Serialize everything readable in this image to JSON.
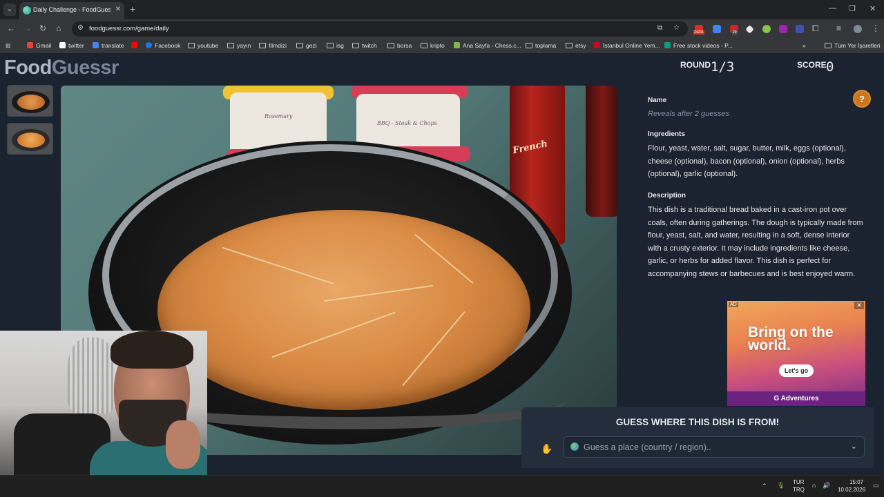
{
  "browser": {
    "tab_title": "Daily Challenge - FoodGuessr |",
    "url": "foodguessr.com/game/daily",
    "bookmarks": [
      {
        "label": "Gmail",
        "kind": "site",
        "color": "#ea4335"
      },
      {
        "label": "twitter",
        "kind": "site",
        "color": "#ffffff"
      },
      {
        "label": "translate",
        "kind": "site",
        "color": "#4285f4"
      },
      {
        "label": "",
        "kind": "site",
        "color": "#ff0000"
      },
      {
        "label": "Facebook",
        "kind": "site",
        "color": "#1877f2"
      },
      {
        "label": "youtube",
        "kind": "folder"
      },
      {
        "label": "yayın",
        "kind": "folder"
      },
      {
        "label": "filmdizi",
        "kind": "folder"
      },
      {
        "label": "gezi",
        "kind": "folder"
      },
      {
        "label": "isg",
        "kind": "folder"
      },
      {
        "label": "twitch",
        "kind": "folder"
      },
      {
        "label": "borsa",
        "kind": "folder"
      },
      {
        "label": "kripto",
        "kind": "folder"
      },
      {
        "label": "Ana Sayfa - Chess.c...",
        "kind": "site",
        "color": "#81b64c"
      },
      {
        "label": "toplama",
        "kind": "folder"
      },
      {
        "label": "etsy",
        "kind": "folder"
      },
      {
        "label": "İstanbul Online Yem...",
        "kind": "site",
        "color": "#d6001c"
      },
      {
        "label": "Free stock videos - P...",
        "kind": "site",
        "color": "#05a081"
      }
    ],
    "all_bookmarks": "Tüm Yer İşaretleri"
  },
  "game": {
    "logo_food": "Food",
    "logo_guessr": "Guessr",
    "round_label": "ROUND",
    "round_value": "1/3",
    "score_label": "SCORE",
    "score_value": "0",
    "help_symbol": "?"
  },
  "panel": {
    "name_title": "Name",
    "name_value": "Reveals after 2 guesses",
    "ingredients_title": "Ingredients",
    "ingredients_text": "Flour, yeast, water, salt, sugar, butter, milk, eggs (optional), cheese (optional), bacon (optional), onion (optional), herbs (optional), garlic (optional).",
    "description_title": "Description",
    "description_text": "This dish is a traditional bread baked in a cast-iron pot over coals, often during gatherings. The dough is typically made from flour, yeast, salt, and water, resulting in a soft, dense interior with a crusty exterior. It may include ingredients like cheese, garlic, or herbs for added flavor. This dish is perfect for accompanying stews or barbecues and is best enjoyed warm."
  },
  "photo_labels": {
    "tub_left": "Rosemary",
    "tub_right": "BBQ - Steak & Chops",
    "bottle": "French"
  },
  "ad": {
    "tag": "AD",
    "headline": "Bring on the world.",
    "cta": "Let's go",
    "brand": "G Adventures"
  },
  "guess": {
    "title": "GUESS WHERE THIS DISH IS FROM!",
    "placeholder": "Guess a place (country / region).."
  },
  "taskbar": {
    "lang_top": "TUR",
    "lang_bottom": "TRQ",
    "time": "15:07",
    "date": "10.02.2026"
  },
  "extensions": {
    "badge_1": "24231",
    "badge_2": "29"
  }
}
